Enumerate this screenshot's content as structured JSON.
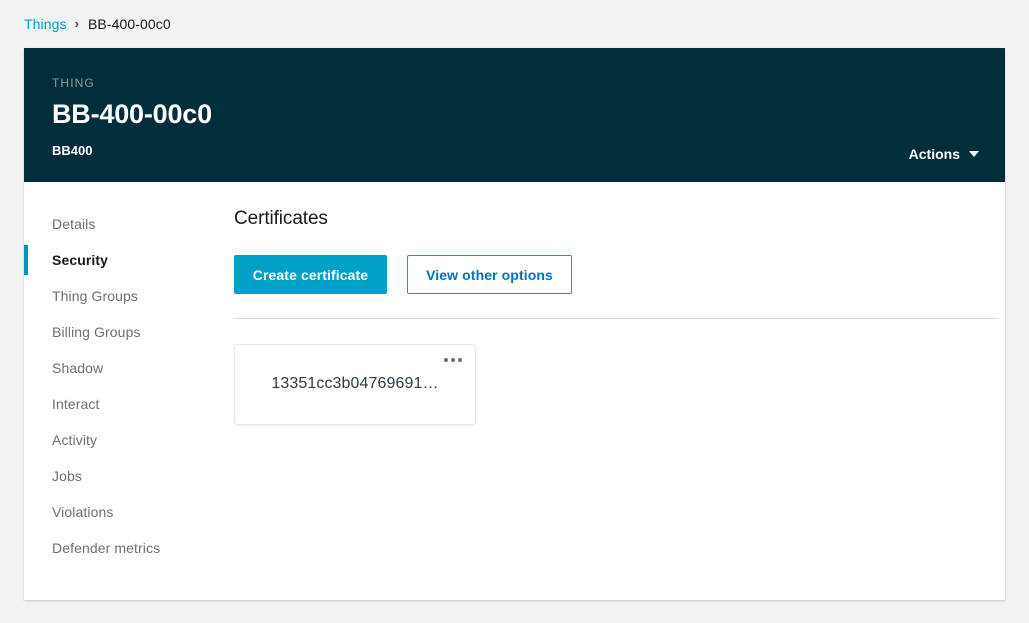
{
  "breadcrumb": {
    "root_label": "Things",
    "separator": "›",
    "current_label": "BB-400-00c0"
  },
  "header": {
    "eyebrow": "THING",
    "title": "BB-400-00c0",
    "subtitle": "BB400",
    "actions_label": "Actions",
    "background_color": "#012e3a"
  },
  "sidebar": {
    "items": [
      {
        "label": "Details",
        "active": false
      },
      {
        "label": "Security",
        "active": true
      },
      {
        "label": "Thing Groups",
        "active": false
      },
      {
        "label": "Billing Groups",
        "active": false
      },
      {
        "label": "Shadow",
        "active": false
      },
      {
        "label": "Interact",
        "active": false
      },
      {
        "label": "Activity",
        "active": false
      },
      {
        "label": "Jobs",
        "active": false
      },
      {
        "label": "Violations",
        "active": false
      },
      {
        "label": "Defender metrics",
        "active": false
      }
    ],
    "active_indicator_color": "#0097bb"
  },
  "content": {
    "title": "Certificates",
    "primary_button_label": "Create certificate",
    "secondary_button_label": "View other options",
    "primary_button_color": "#00a1c9",
    "certificates": [
      {
        "id": "13351cc3b04769691…"
      }
    ]
  }
}
